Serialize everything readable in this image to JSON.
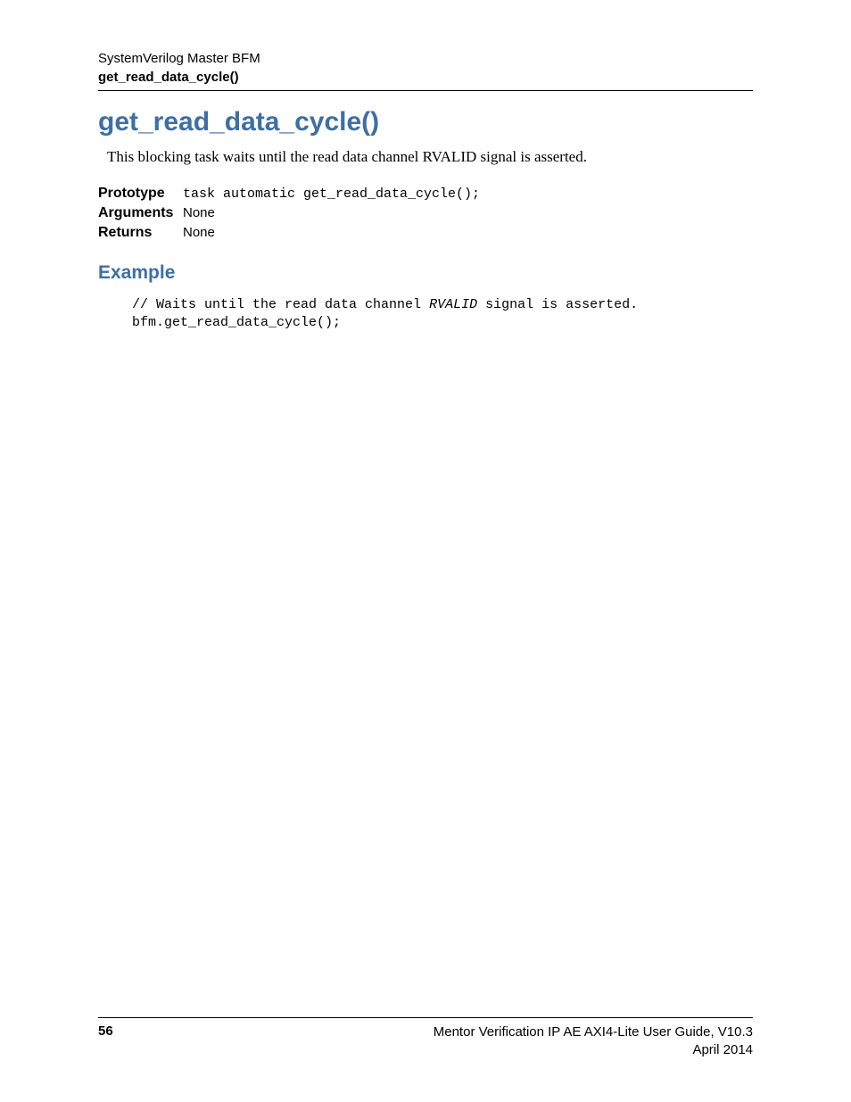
{
  "header": {
    "line1": "SystemVerilog Master BFM",
    "line2": "get_read_data_cycle()"
  },
  "title": "get_read_data_cycle()",
  "intro": "This blocking  task waits until the read data channel RVALID signal is asserted.",
  "defs": {
    "prototype_label": "Prototype",
    "prototype_value": "task automatic get_read_data_cycle();",
    "arguments_label": "Arguments",
    "arguments_value": "None",
    "returns_label": "Returns",
    "returns_value": "None"
  },
  "example": {
    "heading": "Example",
    "line1_pre": "// Waits until the read data channel ",
    "line1_em": "RVALID",
    "line1_post": " signal is asserted.",
    "line2": "bfm.get_read_data_cycle();"
  },
  "footer": {
    "page": "56",
    "guide": "Mentor Verification IP AE AXI4-Lite User Guide, V10.3",
    "date": "April 2014"
  }
}
